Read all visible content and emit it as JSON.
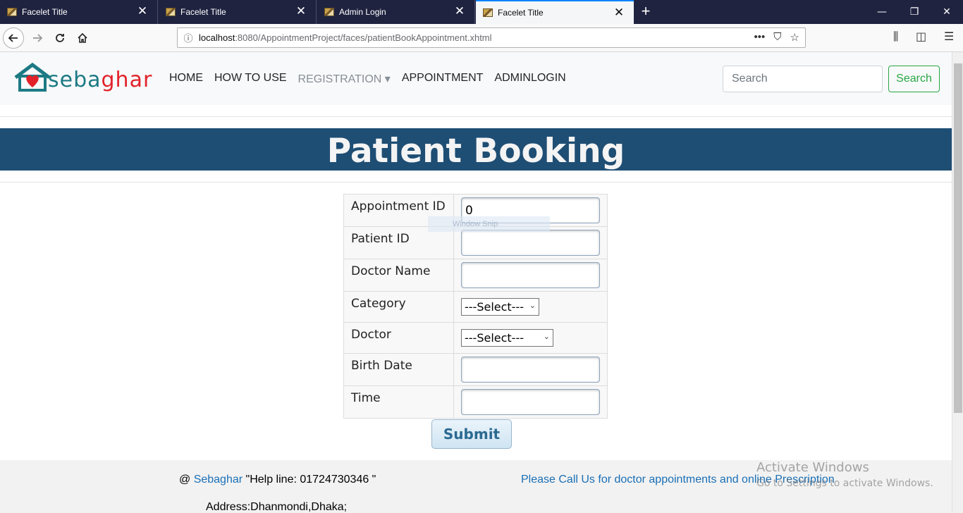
{
  "browser": {
    "tabs": [
      {
        "title": "Facelet Title",
        "active": false
      },
      {
        "title": "Facelet Title",
        "active": false
      },
      {
        "title": "Admin Login",
        "active": false
      },
      {
        "title": "Facelet Title",
        "active": true
      }
    ],
    "new_tab": "+",
    "url_host": "localhost",
    "url_path": ":8080/AppointmentProject/faces/patientBookAppointment.xhtml",
    "window_controls": {
      "minimize": "—",
      "maximize": "❐",
      "close": "✕"
    }
  },
  "site": {
    "logo": {
      "part1": "seba",
      "part2": "ghar"
    },
    "menu": [
      {
        "label": "HOME"
      },
      {
        "label": "HOW TO USE"
      },
      {
        "label": "REGISTRATION ▾"
      },
      {
        "label": "APPOINTMENT"
      },
      {
        "label": "ADMINLOGIN"
      }
    ],
    "search_placeholder": "Search",
    "search_button": "Search"
  },
  "banner": {
    "title": "Patient Booking"
  },
  "form": {
    "rows": [
      {
        "label": "Appointment ID",
        "value": "0",
        "type": "text"
      },
      {
        "label": "Patient ID",
        "value": "",
        "type": "text"
      },
      {
        "label": "Doctor Name",
        "value": "",
        "type": "text"
      },
      {
        "label": "Category",
        "value": "---Select---",
        "type": "select"
      },
      {
        "label": "Doctor",
        "value": "---Select---",
        "type": "select"
      },
      {
        "label": "Birth Date",
        "value": "",
        "type": "text"
      },
      {
        "label": "Time",
        "value": "",
        "type": "text"
      }
    ],
    "submit": "Submit"
  },
  "footer": {
    "at": "@ ",
    "link": "Sebaghar",
    "helpline": " \"Help line: 01724730346 \"",
    "right_text": "Please Call Us for doctor appointments and online Prescription",
    "address": "Address:Dhanmondi,Dhaka;"
  },
  "watermark": {
    "line1": "Activate Windows",
    "line2": "Go to Settings to activate Windows."
  },
  "overlay": {
    "ghost_text": "Window Snip"
  }
}
